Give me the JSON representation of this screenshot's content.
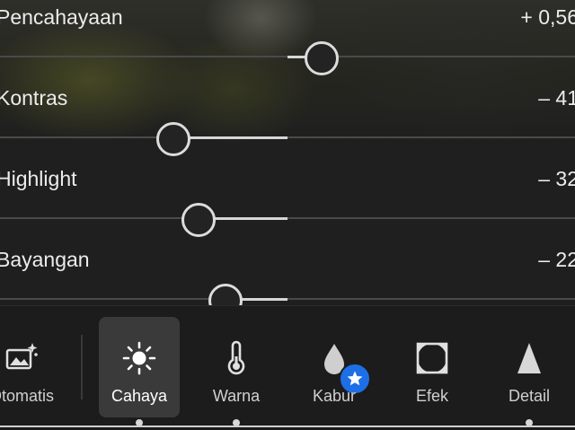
{
  "sliders": [
    {
      "label": "Pencahayaan",
      "value": "+ 0,56",
      "level": 0.56
    },
    {
      "label": "Kontras",
      "value": "– 41",
      "level": -41
    },
    {
      "label": "Highlight",
      "value": "– 32",
      "level": -32
    },
    {
      "label": "Bayangan",
      "value": "– 22",
      "level": -22
    }
  ],
  "toolbar": {
    "items": [
      {
        "label": "Otomatis",
        "icon": "auto-photo-sparkle-icon"
      },
      {
        "label": "Cahaya",
        "icon": "sun-icon",
        "active": true
      },
      {
        "label": "Warna",
        "icon": "thermometer-icon"
      },
      {
        "label": "Kabur",
        "icon": "drop-icon",
        "badge": "premium-star-badge-icon"
      },
      {
        "label": "Efek",
        "icon": "vignette-frame-icon"
      },
      {
        "label": "Detail",
        "icon": "triangle-icon"
      }
    ]
  },
  "colors": {
    "background": "#1f1f1f",
    "badge": "#1e6fe6",
    "active_tab": "#3a3a3a"
  }
}
